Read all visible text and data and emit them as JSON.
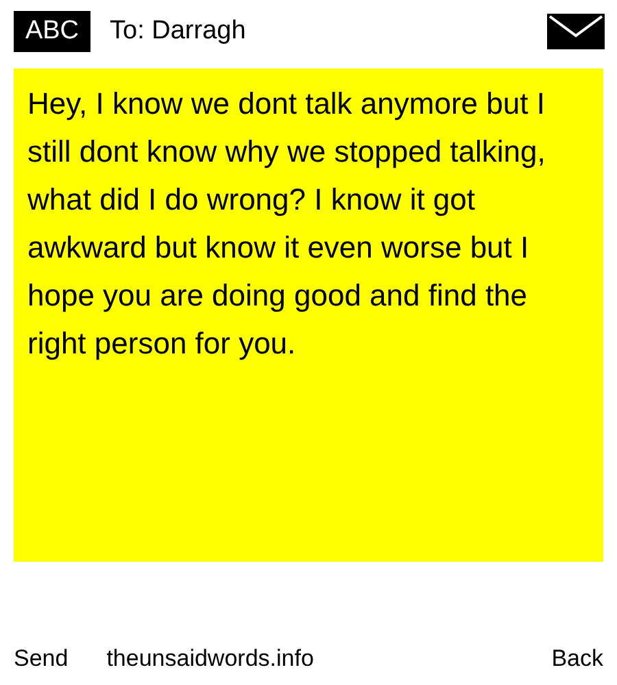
{
  "header": {
    "badge": "ABC",
    "recipient": "To: Darragh"
  },
  "message": "Hey, I know we dont talk anymore but I still dont know why we stopped talking, what did I do wrong? I know it got awkward but know it even worse but I hope you are doing good and find the right person for you.",
  "footer": {
    "send": "Send",
    "site": "theunsaidwords.info",
    "back": "Back"
  }
}
